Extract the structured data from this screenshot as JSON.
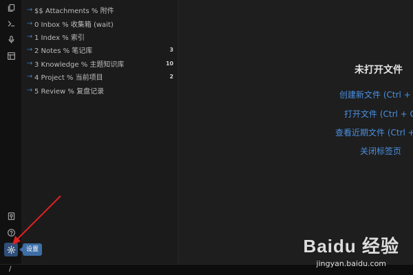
{
  "ribbon": {
    "icons": [
      "files-icon",
      "terminal-icon",
      "microphone-icon",
      "layout-icon",
      "map-pin-icon",
      "help-icon",
      "gear-icon"
    ]
  },
  "sidebar": {
    "items": [
      {
        "label": "$$ Attachments % 附件",
        "count": ""
      },
      {
        "label": "0 Inbox % 收集箱 (wait)",
        "count": ""
      },
      {
        "label": "1 Index % 索引",
        "count": ""
      },
      {
        "label": "2 Notes % 笔记库",
        "count": "3"
      },
      {
        "label": "3 Knowledge % 主题知识库",
        "count": "10"
      },
      {
        "label": "4 Project % 当前项目",
        "count": "2"
      },
      {
        "label": "5 Review % 复盘记录",
        "count": ""
      }
    ]
  },
  "main": {
    "empty_title": "未打开文件",
    "actions": [
      "创建新文件 (Ctrl + N)",
      "打开文件 (Ctrl + O)",
      "查看近期文件 (Ctrl + O)",
      "关闭标签页"
    ]
  },
  "tooltip": {
    "label": "设置"
  },
  "statusbar": {
    "text": "/"
  },
  "watermark": {
    "brand": "Baidu 经验",
    "site": "jingyan.baidu.com"
  },
  "colors": {
    "accent": "#4a90e2",
    "annotation": "#e02020"
  }
}
